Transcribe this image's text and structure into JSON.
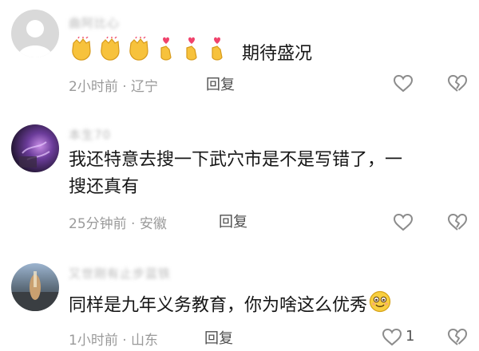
{
  "comments": [
    {
      "username": "曲阿比心",
      "text": "期待盛况",
      "emojis": [
        "clapping-hands-emoji",
        "clapping-hands-emoji",
        "clapping-hands-emoji",
        "finger-heart-emoji",
        "finger-heart-emoji",
        "finger-heart-emoji"
      ],
      "time": "2小时前",
      "sep": "·",
      "location": "辽宁",
      "reply_label": "回复",
      "like_count": ""
    },
    {
      "username": "本生70",
      "text_line1": "我还特意去搜一下武穴市是不是写错了，一",
      "text_line2": "搜还真有",
      "time": "25分钟前",
      "sep": "·",
      "location": "安徽",
      "reply_label": "回复",
      "like_count": ""
    },
    {
      "username": "又世刚有止步蓝铁",
      "text": "同样是九年义务教育，你为啥这么优秀",
      "emojis": [
        "smiling-face-emoji"
      ],
      "time": "1小时前",
      "sep": "·",
      "location": "山东",
      "reply_label": "回复",
      "like_count": "1"
    }
  ],
  "icons": {
    "like": "heart-outline-icon",
    "dislike": "broken-heart-icon"
  }
}
